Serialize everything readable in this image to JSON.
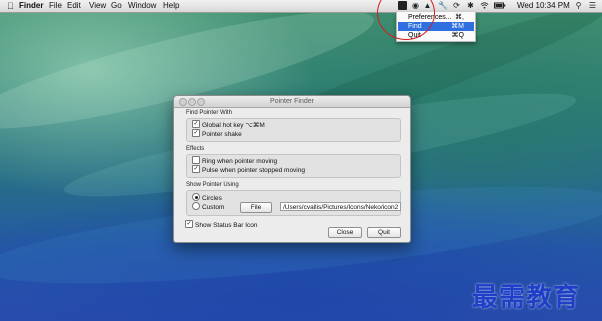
{
  "menubar": {
    "apple_icon": "apple-logo",
    "app_name": "Finder",
    "items": [
      "File",
      "Edit",
      "View",
      "Go",
      "Window",
      "Help"
    ],
    "clock": "Wed 10:34 PM",
    "status_icons": [
      "pointer-finder-icon",
      "creative-cloud-icon",
      "drive-icon",
      "wrench-icon",
      "time-machine-icon",
      "bluetooth-icon",
      "wifi-icon",
      "battery-icon",
      "search-icon",
      "list-icon"
    ]
  },
  "status_menu": {
    "items": [
      {
        "label": "Preferences...",
        "shortcut": "⌘,"
      },
      {
        "label": "Find",
        "shortcut": "⌘M"
      },
      {
        "label": "Quit",
        "shortcut": "⌘Q"
      }
    ],
    "highlighted": "Find"
  },
  "window": {
    "title": "Pointer Finder",
    "find_section": {
      "label": "Find Pointer With",
      "options": [
        {
          "label": "Global hot key ⌥⌘M",
          "checked": true
        },
        {
          "label": "Pointer shake",
          "checked": true
        }
      ]
    },
    "effects_section": {
      "label": "Effects",
      "options": [
        {
          "label": "Ring when pointer moving",
          "checked": false
        },
        {
          "label": "Pulse when pointer stopped moving",
          "checked": true
        }
      ]
    },
    "show_section": {
      "label": "Show Pointer Using",
      "options": [
        {
          "label": "Circles",
          "selected": true
        },
        {
          "label": "Custom",
          "selected": false
        }
      ],
      "file_button": "File",
      "path_value": "/Users/cvallis/Pictures/Icons/Neko/icon2"
    },
    "status_bar_option": {
      "label": "Show Status Bar Icon",
      "checked": true
    },
    "close_button": "Close",
    "quit_button": "Quit"
  },
  "watermark": "最需教育",
  "colors": {
    "menu_highlight": "#2f6fe0",
    "annotation_circle": "#d21d1d",
    "watermark": "#1f3fc8"
  }
}
